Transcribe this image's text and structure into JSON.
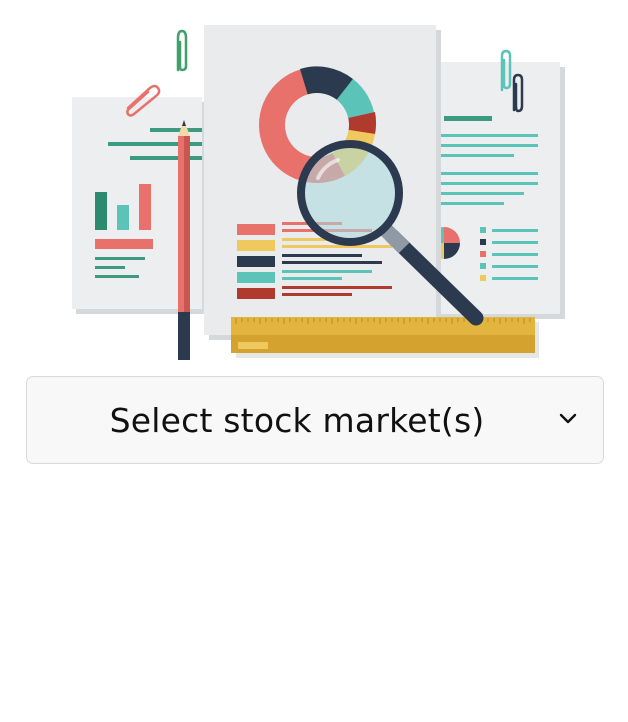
{
  "illustration": {
    "icon": "data-analysis-illustration"
  },
  "market_select": {
    "label": "Select stock market(s)",
    "chevron_icon": "chevron-down-icon"
  },
  "colors": {
    "coral": "#e8716b",
    "navy": "#2b3a4f",
    "teal": "#5cc3b8",
    "yellow": "#f0c95e",
    "green": "#2e8a6e",
    "paper": "#eceeef",
    "ruler": "#e3b53e"
  }
}
